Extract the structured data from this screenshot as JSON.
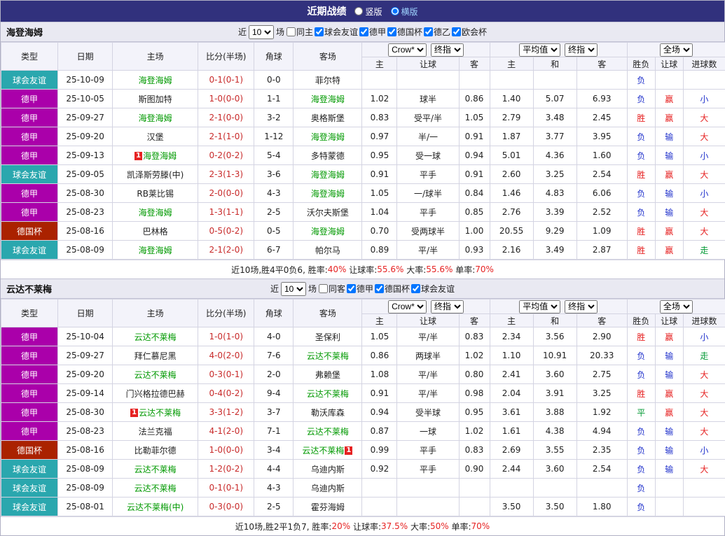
{
  "title_bar": {
    "title": "近期战绩",
    "radio_vertical": "竖版",
    "radio_horizontal": "横版",
    "selected": "横版"
  },
  "colors": {
    "title_bar_bg": "#31317d",
    "section_header_bg": "#e9e9f2",
    "table_header_bg": "#f3f3fa",
    "win_red": "#e62222",
    "lose_blue": "#2233cc",
    "draw_green": "#009933",
    "score_red": "#c82a2a",
    "focus_team_green": "#009900",
    "type_colors": {
      "球会友谊": "#2aa7ae",
      "德甲": "#aa00aa",
      "德国杯": "#aa2200"
    }
  },
  "table_header": {
    "cols": [
      "类型",
      "日期",
      "主场",
      "比分(半场)",
      "角球",
      "客场"
    ],
    "odds_subcols": [
      "主",
      "让球",
      "客",
      "主",
      "和",
      "客"
    ],
    "result_subcols": [
      "胜负",
      "让球",
      "进球数"
    ],
    "selects": {
      "book": "Crow*",
      "book_stage": "终指",
      "avg": "平均值",
      "avg_stage": "终指",
      "scope": "全场"
    }
  },
  "sections": [
    {
      "title": "海登海姆",
      "filter": {
        "near": "近",
        "count": "10",
        "games": "场",
        "checkboxes": [
          {
            "label": "同主",
            "checked": false
          },
          {
            "label": "球会友谊",
            "checked": true
          },
          {
            "label": "德甲",
            "checked": true
          },
          {
            "label": "德国杯",
            "checked": true
          },
          {
            "label": "德乙",
            "checked": true
          },
          {
            "label": "欧会杯",
            "checked": true
          }
        ]
      },
      "rows": [
        {
          "type": "球会友谊",
          "date": "25-10-09",
          "home": {
            "name": "海登海姆",
            "focus": true
          },
          "score": "0-1(0-1)",
          "corners": "0-0",
          "away": {
            "name": "菲尔特"
          },
          "odds": [
            "",
            "",
            "",
            "",
            "",
            ""
          ],
          "res": [
            "负",
            "",
            ""
          ]
        },
        {
          "type": "德甲",
          "date": "25-10-05",
          "home": {
            "name": "斯图加特"
          },
          "score": "1-0(0-0)",
          "corners": "1-1",
          "away": {
            "name": "海登海姆",
            "focus": true
          },
          "odds": [
            "1.02",
            "球半",
            "0.86",
            "1.40",
            "5.07",
            "6.93"
          ],
          "res": [
            "负",
            "赢",
            "小"
          ]
        },
        {
          "type": "德甲",
          "date": "25-09-27",
          "home": {
            "name": "海登海姆",
            "focus": true
          },
          "score": "2-1(0-0)",
          "corners": "3-2",
          "away": {
            "name": "奥格斯堡"
          },
          "odds": [
            "0.83",
            "受平/半",
            "1.05",
            "2.79",
            "3.48",
            "2.45"
          ],
          "res": [
            "胜",
            "赢",
            "大"
          ]
        },
        {
          "type": "德甲",
          "date": "25-09-20",
          "home": {
            "name": "汉堡"
          },
          "score": "2-1(1-0)",
          "corners": "1-12",
          "away": {
            "name": "海登海姆",
            "focus": true
          },
          "odds": [
            "0.97",
            "半/一",
            "0.91",
            "1.87",
            "3.77",
            "3.95"
          ],
          "res": [
            "负",
            "输",
            "大"
          ]
        },
        {
          "type": "德甲",
          "date": "25-09-13",
          "home": {
            "name": "海登海姆",
            "focus": true,
            "card": "before"
          },
          "score": "0-2(0-2)",
          "corners": "5-4",
          "away": {
            "name": "多特蒙德"
          },
          "odds": [
            "0.95",
            "受一球",
            "0.94",
            "5.01",
            "4.36",
            "1.60"
          ],
          "res": [
            "负",
            "输",
            "小"
          ]
        },
        {
          "type": "球会友谊",
          "date": "25-09-05",
          "home": {
            "name": "凯泽斯劳滕(中)"
          },
          "score": "2-3(1-3)",
          "corners": "3-6",
          "away": {
            "name": "海登海姆",
            "focus": true
          },
          "odds": [
            "0.91",
            "平手",
            "0.91",
            "2.60",
            "3.25",
            "2.54"
          ],
          "res": [
            "胜",
            "赢",
            "大"
          ]
        },
        {
          "type": "德甲",
          "date": "25-08-30",
          "home": {
            "name": "RB莱比锡"
          },
          "score": "2-0(0-0)",
          "corners": "4-3",
          "away": {
            "name": "海登海姆",
            "focus": true
          },
          "odds": [
            "1.05",
            "一/球半",
            "0.84",
            "1.46",
            "4.83",
            "6.06"
          ],
          "res": [
            "负",
            "输",
            "小"
          ]
        },
        {
          "type": "德甲",
          "date": "25-08-23",
          "home": {
            "name": "海登海姆",
            "focus": true
          },
          "score": "1-3(1-1)",
          "corners": "2-5",
          "away": {
            "name": "沃尔夫斯堡"
          },
          "odds": [
            "1.04",
            "平手",
            "0.85",
            "2.76",
            "3.39",
            "2.52"
          ],
          "res": [
            "负",
            "输",
            "大"
          ]
        },
        {
          "type": "德国杯",
          "date": "25-08-16",
          "home": {
            "name": "巴林格"
          },
          "score": "0-5(0-2)",
          "corners": "0-5",
          "away": {
            "name": "海登海姆",
            "focus": true
          },
          "odds": [
            "0.70",
            "受两球半",
            "1.00",
            "20.55",
            "9.29",
            "1.09"
          ],
          "res": [
            "胜",
            "赢",
            "大"
          ]
        },
        {
          "type": "球会友谊",
          "date": "25-08-09",
          "home": {
            "name": "海登海姆",
            "focus": true
          },
          "score": "2-1(2-0)",
          "corners": "6-7",
          "away": {
            "name": "帕尔马"
          },
          "odds": [
            "0.89",
            "平/半",
            "0.93",
            "2.16",
            "3.49",
            "2.87"
          ],
          "res": [
            "胜",
            "赢",
            "走"
          ]
        }
      ],
      "summary": [
        {
          "t": "近10场,胜4平0负6, ",
          "c": "dark"
        },
        {
          "t": "胜率:",
          "c": "dark"
        },
        {
          "t": "40%",
          "c": "red"
        },
        {
          "t": " 让球率:",
          "c": "dark"
        },
        {
          "t": "55.6%",
          "c": "red"
        },
        {
          "t": " 大率:",
          "c": "dark"
        },
        {
          "t": "55.6%",
          "c": "red"
        },
        {
          "t": " 单率:",
          "c": "dark"
        },
        {
          "t": "70%",
          "c": "red"
        }
      ]
    },
    {
      "title": "云达不莱梅",
      "filter": {
        "near": "近",
        "count": "10",
        "games": "场",
        "checkboxes": [
          {
            "label": "同客",
            "checked": false
          },
          {
            "label": "德甲",
            "checked": true
          },
          {
            "label": "德国杯",
            "checked": true
          },
          {
            "label": "球会友谊",
            "checked": true
          }
        ]
      },
      "rows": [
        {
          "type": "德甲",
          "date": "25-10-04",
          "home": {
            "name": "云达不莱梅",
            "focus": true
          },
          "score": "1-0(1-0)",
          "corners": "4-0",
          "away": {
            "name": "圣保利"
          },
          "odds": [
            "1.05",
            "平/半",
            "0.83",
            "2.34",
            "3.56",
            "2.90"
          ],
          "res": [
            "胜",
            "赢",
            "小"
          ]
        },
        {
          "type": "德甲",
          "date": "25-09-27",
          "home": {
            "name": "拜仁慕尼黑"
          },
          "score": "4-0(2-0)",
          "corners": "7-6",
          "away": {
            "name": "云达不莱梅",
            "focus": true
          },
          "odds": [
            "0.86",
            "两球半",
            "1.02",
            "1.10",
            "10.91",
            "20.33"
          ],
          "res": [
            "负",
            "输",
            "走"
          ]
        },
        {
          "type": "德甲",
          "date": "25-09-20",
          "home": {
            "name": "云达不莱梅",
            "focus": true
          },
          "score": "0-3(0-1)",
          "corners": "2-0",
          "away": {
            "name": "弗赖堡"
          },
          "odds": [
            "1.08",
            "平/半",
            "0.80",
            "2.41",
            "3.60",
            "2.75"
          ],
          "res": [
            "负",
            "输",
            "大"
          ]
        },
        {
          "type": "德甲",
          "date": "25-09-14",
          "home": {
            "name": "门兴格拉德巴赫"
          },
          "score": "0-4(0-2)",
          "corners": "9-4",
          "away": {
            "name": "云达不莱梅",
            "focus": true
          },
          "odds": [
            "0.91",
            "平/半",
            "0.98",
            "2.04",
            "3.91",
            "3.25"
          ],
          "res": [
            "胜",
            "赢",
            "大"
          ]
        },
        {
          "type": "德甲",
          "date": "25-08-30",
          "home": {
            "name": "云达不莱梅",
            "focus": true,
            "card": "before"
          },
          "score": "3-3(1-2)",
          "corners": "3-7",
          "away": {
            "name": "勒沃库森"
          },
          "odds": [
            "0.94",
            "受半球",
            "0.95",
            "3.61",
            "3.88",
            "1.92"
          ],
          "res": [
            "平",
            "赢",
            "大"
          ]
        },
        {
          "type": "德甲",
          "date": "25-08-23",
          "home": {
            "name": "法兰克福"
          },
          "score": "4-1(2-0)",
          "corners": "7-1",
          "away": {
            "name": "云达不莱梅",
            "focus": true
          },
          "odds": [
            "0.87",
            "一球",
            "1.02",
            "1.61",
            "4.38",
            "4.94"
          ],
          "res": [
            "负",
            "输",
            "大"
          ]
        },
        {
          "type": "德国杯",
          "date": "25-08-16",
          "home": {
            "name": "比勒菲尔德"
          },
          "score": "1-0(0-0)",
          "corners": "3-4",
          "away": {
            "name": "云达不莱梅",
            "focus": true,
            "card": "after"
          },
          "odds": [
            "0.99",
            "平手",
            "0.83",
            "2.69",
            "3.55",
            "2.35"
          ],
          "res": [
            "负",
            "输",
            "小"
          ]
        },
        {
          "type": "球会友谊",
          "date": "25-08-09",
          "home": {
            "name": "云达不莱梅",
            "focus": true
          },
          "score": "1-2(0-2)",
          "corners": "4-4",
          "away": {
            "name": "乌迪内斯"
          },
          "odds": [
            "0.92",
            "平手",
            "0.90",
            "2.44",
            "3.60",
            "2.54"
          ],
          "res": [
            "负",
            "输",
            "大"
          ]
        },
        {
          "type": "球会友谊",
          "date": "25-08-09",
          "home": {
            "name": "云达不莱梅",
            "focus": true
          },
          "score": "0-1(0-1)",
          "corners": "4-3",
          "away": {
            "name": "乌迪内斯"
          },
          "odds": [
            "",
            "",
            "",
            "",
            "",
            ""
          ],
          "res": [
            "负",
            "",
            ""
          ]
        },
        {
          "type": "球会友谊",
          "date": "25-08-01",
          "home": {
            "name": "云达不莱梅(中)",
            "focus": true
          },
          "score": "0-3(0-0)",
          "corners": "2-5",
          "away": {
            "name": "霍芬海姆"
          },
          "odds": [
            "",
            "",
            "",
            "3.50",
            "3.50",
            "1.80"
          ],
          "res": [
            "负",
            "",
            ""
          ]
        }
      ],
      "summary": [
        {
          "t": "近10场,胜2平1负7, ",
          "c": "dark"
        },
        {
          "t": "胜率:",
          "c": "dark"
        },
        {
          "t": "20%",
          "c": "red"
        },
        {
          "t": " 让球率:",
          "c": "dark"
        },
        {
          "t": "37.5%",
          "c": "red"
        },
        {
          "t": " 大率:",
          "c": "dark"
        },
        {
          "t": "50%",
          "c": "red"
        },
        {
          "t": " 单率:",
          "c": "dark"
        },
        {
          "t": "70%",
          "c": "red"
        }
      ]
    }
  ]
}
